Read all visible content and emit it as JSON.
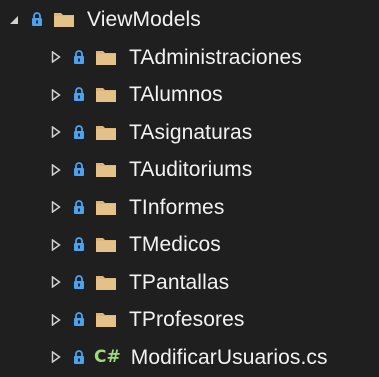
{
  "colors": {
    "background": "#1f1f1f",
    "folder": "#dcb67a",
    "lock": "#4aa3f0",
    "text": "#f2f2f2",
    "arrow": "#d0d0d0",
    "csharp": "#9fd97c"
  },
  "tree": {
    "root": {
      "label": "ViewModels",
      "expanded": true,
      "icons": [
        "expanded-arrow-icon",
        "lock-icon",
        "folder-icon"
      ]
    },
    "children": [
      {
        "label": "TAdministraciones",
        "type": "folder",
        "expanded": false
      },
      {
        "label": "TAlumnos",
        "type": "folder",
        "expanded": false
      },
      {
        "label": "TAsignaturas",
        "type": "folder",
        "expanded": false
      },
      {
        "label": "TAuditoriums",
        "type": "folder",
        "expanded": false
      },
      {
        "label": "TInformes",
        "type": "folder",
        "expanded": false
      },
      {
        "label": "TMedicos",
        "type": "folder",
        "expanded": false
      },
      {
        "label": "TPantallas",
        "type": "folder",
        "expanded": false
      },
      {
        "label": "TProfesores",
        "type": "folder",
        "expanded": false
      },
      {
        "label": "ModificarUsuarios.cs",
        "type": "csharp-file",
        "icon_text": "C#",
        "expanded": false
      }
    ]
  }
}
